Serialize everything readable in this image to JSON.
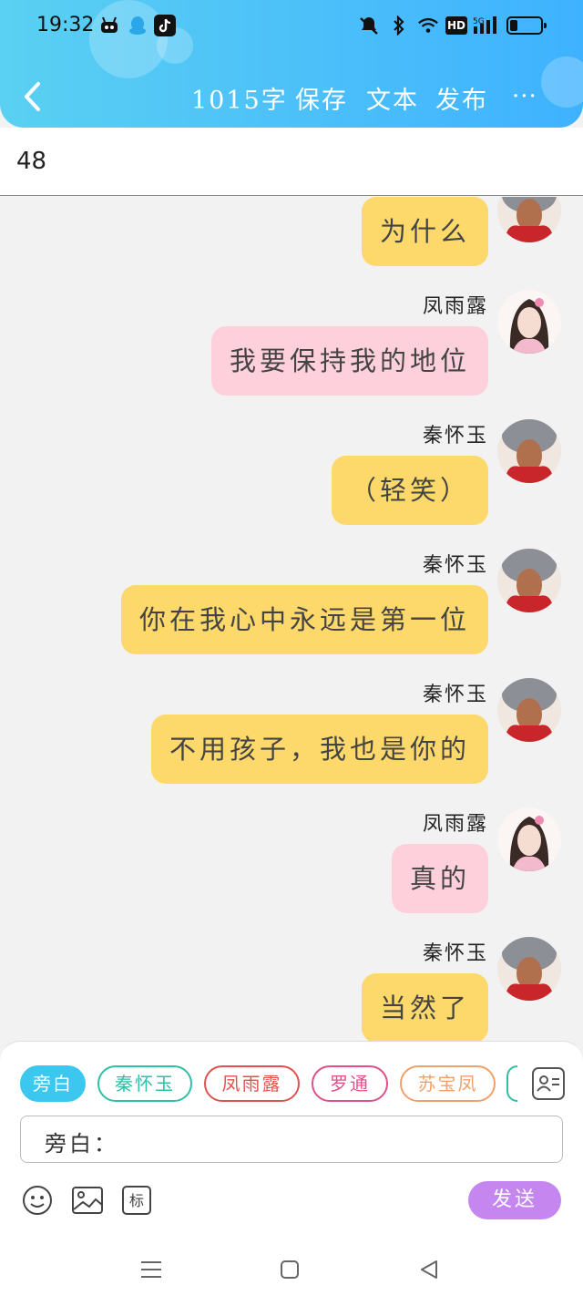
{
  "status_bar": {
    "time": "19:32",
    "icons": [
      "android-bot-icon",
      "qq-penguin-icon",
      "tiktok-icon",
      "mute-icon",
      "bluetooth-icon",
      "wifi-icon",
      "hd-icon",
      "signal-5g-icon",
      "battery-icon"
    ],
    "hd_label": "HD",
    "network_label": "5G"
  },
  "header": {
    "word_count": "1015字",
    "save": "保存",
    "text": "文本",
    "publish": "发布",
    "more": "···"
  },
  "title_field": {
    "value": "48"
  },
  "messages": [
    {
      "speaker": "",
      "text": "为什么",
      "color": "yellow",
      "avatar": "male-warrior"
    },
    {
      "speaker": "凤雨露",
      "text": "我要保持我的地位",
      "color": "pink",
      "avatar": "female-costume"
    },
    {
      "speaker": "秦怀玉",
      "text": "（轻笑）",
      "color": "yellow",
      "avatar": "male-warrior"
    },
    {
      "speaker": "秦怀玉",
      "text": "你在我心中永远是第一位",
      "color": "yellow",
      "avatar": "male-warrior"
    },
    {
      "speaker": "秦怀玉",
      "text": "不用孩子，我也是你的",
      "color": "yellow",
      "avatar": "male-warrior"
    },
    {
      "speaker": "凤雨露",
      "text": "真的",
      "color": "pink",
      "avatar": "female-costume"
    },
    {
      "speaker": "秦怀玉",
      "text": "当然了",
      "color": "yellow",
      "avatar": "male-warrior"
    }
  ],
  "composer": {
    "roles": [
      {
        "label": "旁白",
        "active": true,
        "color": "#3cc7ee"
      },
      {
        "label": "秦怀玉",
        "active": false,
        "color": "#2fbfa8"
      },
      {
        "label": "凤雨露",
        "active": false,
        "color": "#e0524f"
      },
      {
        "label": "罗通",
        "active": false,
        "color": "#e0508a"
      },
      {
        "label": "苏宝凤",
        "active": false,
        "color": "#f0a06a"
      }
    ],
    "input_label": "旁白：",
    "tools": [
      "emoji-icon",
      "image-icon",
      "tag-icon"
    ],
    "tag_label": "标",
    "send_label": "发送"
  },
  "colors": {
    "header_gradient": [
      "#5ad0f2",
      "#3fb2ff"
    ],
    "bubble_yellow": "#fdd86a",
    "bubble_pink": "#fed0dc",
    "send_button": "#c586f0"
  }
}
